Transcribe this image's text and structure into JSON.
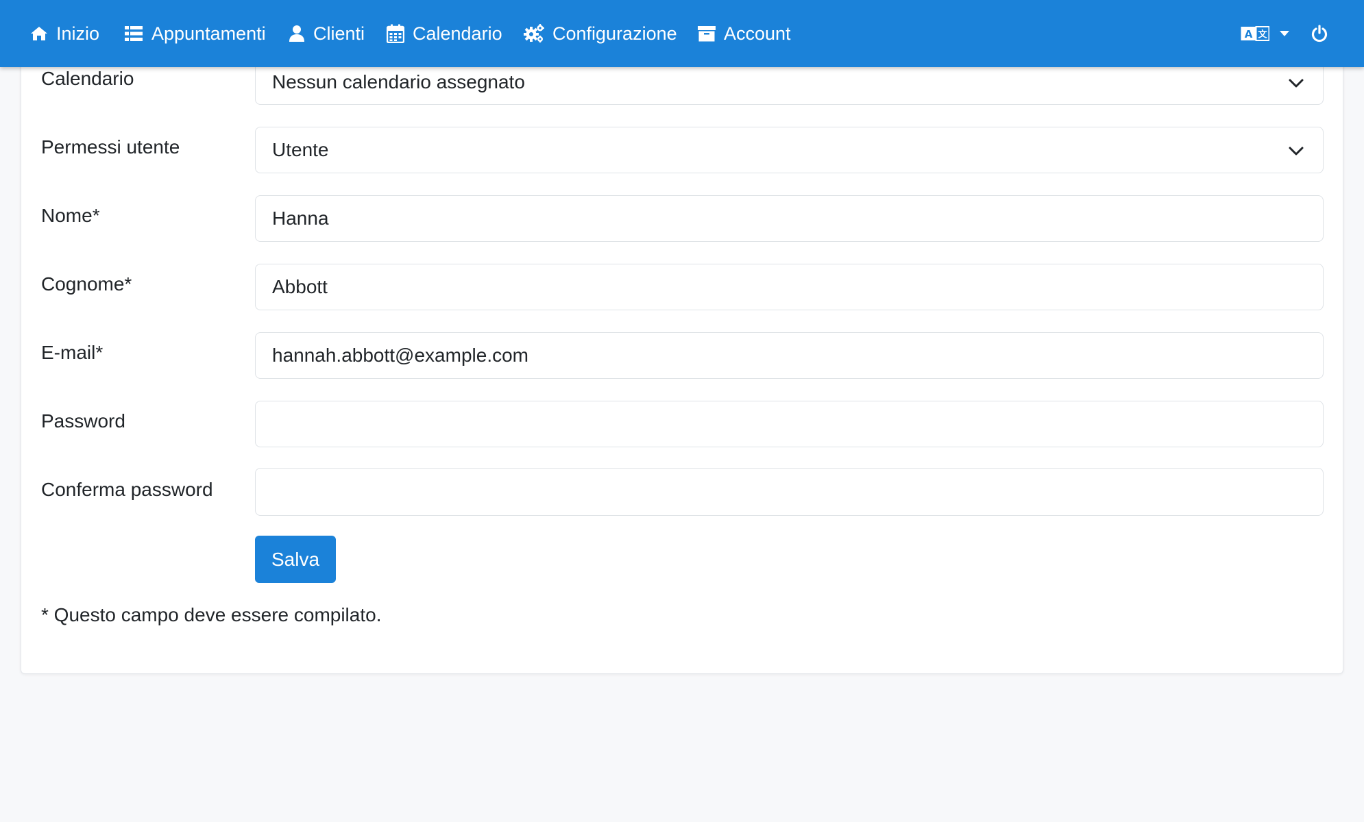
{
  "nav": {
    "items": [
      {
        "label": "Inizio",
        "icon": "home-icon"
      },
      {
        "label": "Appuntamenti",
        "icon": "list-icon"
      },
      {
        "label": "Clienti",
        "icon": "user-icon"
      },
      {
        "label": "Calendario",
        "icon": "calendar-icon"
      },
      {
        "label": "Configurazione",
        "icon": "cogs-icon"
      },
      {
        "label": "Account",
        "icon": "archive-icon"
      }
    ],
    "right_icons": [
      "language-icon",
      "caret-down-icon",
      "power-icon"
    ]
  },
  "form": {
    "calendar": {
      "label": "Calendario",
      "value": "Nessun calendario assegnato"
    },
    "permissions": {
      "label": "Permessi utente",
      "value": "Utente"
    },
    "first_name": {
      "label": "Nome*",
      "value": "Hanna"
    },
    "last_name": {
      "label": "Cognome*",
      "value": "Abbott"
    },
    "email": {
      "label": "E-mail*",
      "value": "hannah.abbott@example.com"
    },
    "password": {
      "label": "Password",
      "value": ""
    },
    "confirm_password": {
      "label": "Conferma password",
      "value": ""
    },
    "save_label": "Salva",
    "required_note": "* Questo campo deve essere compilato."
  },
  "colors": {
    "primary": "#1b82d9",
    "background": "#f7f8fa",
    "border": "#dee2e6"
  }
}
